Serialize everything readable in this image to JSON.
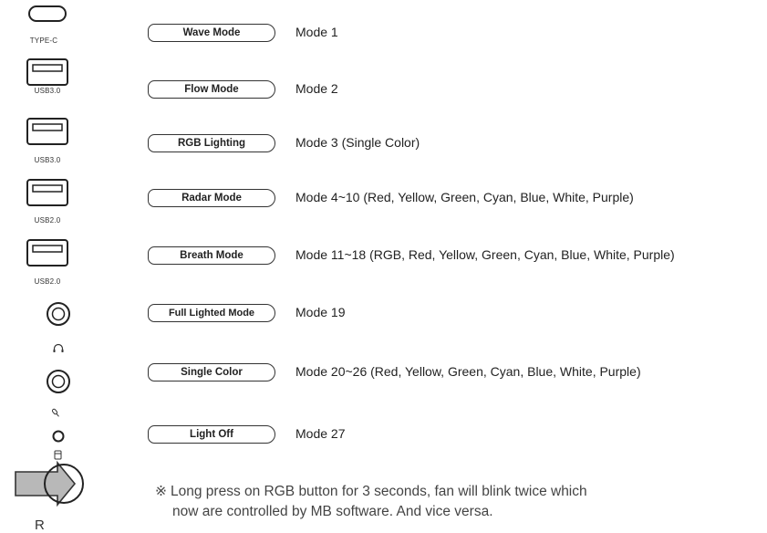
{
  "ports": [
    {
      "label": "TYPE-C",
      "icon": "usb-c-port-icon"
    },
    {
      "label": "USB3.0",
      "icon": "usb-a-port-icon"
    },
    {
      "label": "USB3.0",
      "icon": "usb-a-port-icon"
    },
    {
      "label": "USB2.0",
      "icon": "usb-a-port-icon"
    },
    {
      "label": "USB2.0",
      "icon": "usb-a-port-icon"
    }
  ],
  "modes": [
    {
      "button": "Wave Mode",
      "desc": "Mode 1"
    },
    {
      "button": "Flow Mode",
      "desc": "Mode 2"
    },
    {
      "button": "RGB Lighting",
      "desc": "Mode 3 (Single Color)"
    },
    {
      "button": "Radar Mode",
      "desc": "Mode 4~10 (Red, Yellow, Green, Cyan, Blue, White, Purple)"
    },
    {
      "button": "Breath Mode",
      "desc": "Mode 11~18 (RGB, Red, Yellow, Green, Cyan, Blue, White, Purple)"
    },
    {
      "button": "Full Lighted Mode",
      "desc": "Mode 19"
    },
    {
      "button": "Single Color",
      "desc": "Mode 20~26 (Red, Yellow, Green, Cyan, Blue, White, Purple)"
    },
    {
      "button": "Light Off",
      "desc": "Mode 27"
    }
  ],
  "rgb_button_label": "R",
  "note": {
    "symbol": "※",
    "line1": "Long press on RGB button for 3 seconds, fan will blink twice which",
    "line2": "now are controlled by MB software. And vice versa."
  }
}
